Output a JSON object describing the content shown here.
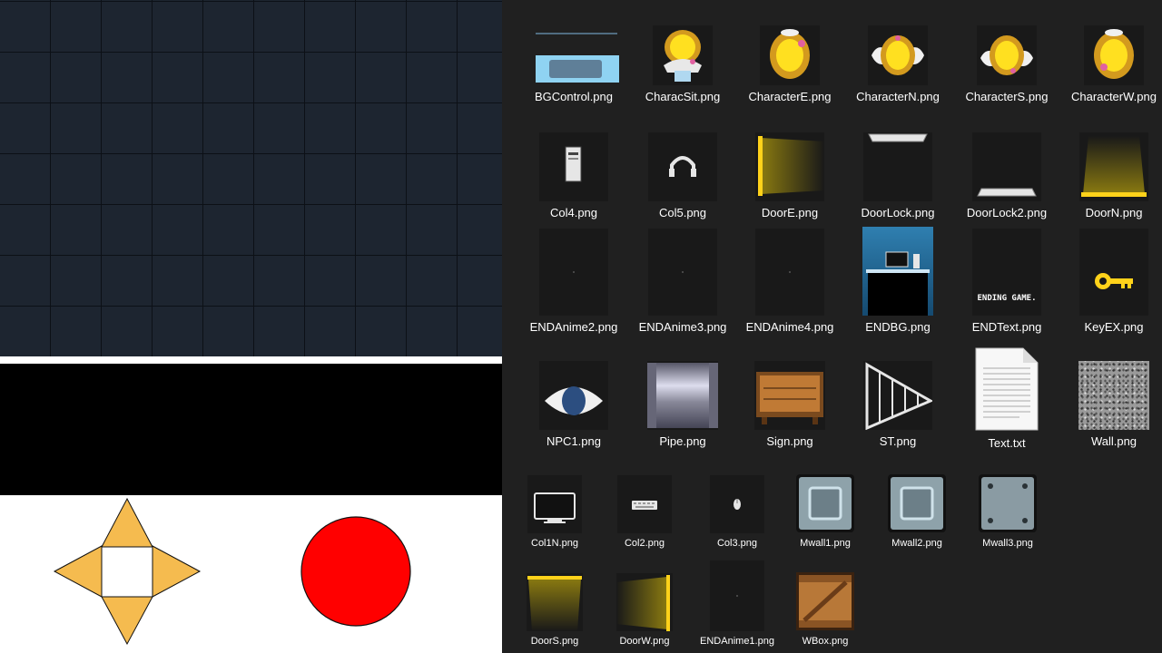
{
  "colors": {
    "grid_bg": "#1d2530",
    "explorer_bg": "#202020",
    "dpad_fill": "#f5bb4f",
    "button_fill": "#ff0000",
    "text": "#ffffff"
  },
  "game": {
    "dpad_icon": "dpad-icon",
    "action_button_icon": "red-circle-button-icon"
  },
  "files": [
    {
      "name": "BGControl.png",
      "icon": "bgcontrol-thumbnail"
    },
    {
      "name": "CharacSit.png",
      "icon": "character-sit-thumbnail"
    },
    {
      "name": "CharacterE.png",
      "icon": "character-east-thumbnail"
    },
    {
      "name": "CharacterN.png",
      "icon": "character-north-thumbnail"
    },
    {
      "name": "CharacterS.png",
      "icon": "character-south-thumbnail"
    },
    {
      "name": "CharacterW.png",
      "icon": "character-west-thumbnail"
    },
    {
      "name": "Col4.png",
      "icon": "pc-tower-thumbnail"
    },
    {
      "name": "Col5.png",
      "icon": "headphones-thumbnail"
    },
    {
      "name": "DoorE.png",
      "icon": "door-east-thumbnail"
    },
    {
      "name": "DoorLock.png",
      "icon": "door-lock-thumbnail"
    },
    {
      "name": "DoorLock2.png",
      "icon": "door-lock2-thumbnail"
    },
    {
      "name": "DoorN.png",
      "icon": "door-north-thumbnail"
    },
    {
      "name": "ENDAnime2.png",
      "icon": "end-anime-thumbnail"
    },
    {
      "name": "ENDAnime3.png",
      "icon": "end-anime-thumbnail"
    },
    {
      "name": "ENDAnime4.png",
      "icon": "end-anime-thumbnail"
    },
    {
      "name": "ENDBG.png",
      "icon": "end-background-thumbnail"
    },
    {
      "name": "ENDText.png",
      "icon": "end-text-thumbnail",
      "caption": "ENDING GAME."
    },
    {
      "name": "KeyEX.png",
      "icon": "key-thumbnail"
    },
    {
      "name": "NPC1.png",
      "icon": "npc-thumbnail"
    },
    {
      "name": "Pipe.png",
      "icon": "pipe-thumbnail"
    },
    {
      "name": "Sign.png",
      "icon": "sign-thumbnail"
    },
    {
      "name": "ST.png",
      "icon": "stairs-thumbnail"
    },
    {
      "name": "Text.txt",
      "icon": "text-document-icon"
    },
    {
      "name": "Wall.png",
      "icon": "wall-texture-thumbnail"
    },
    {
      "name": "Col1N.png",
      "icon": "monitor-thumbnail"
    },
    {
      "name": "Col2.png",
      "icon": "keyboard-thumbnail"
    },
    {
      "name": "Col3.png",
      "icon": "mouse-thumbnail"
    },
    {
      "name": "Mwall1.png",
      "icon": "metal-wall-thumbnail"
    },
    {
      "name": "Mwall2.png",
      "icon": "metal-wall-thumbnail"
    },
    {
      "name": "Mwall3.png",
      "icon": "metal-wall-bolted-thumbnail"
    },
    {
      "name": "DoorS.png",
      "icon": "door-south-thumbnail"
    },
    {
      "name": "DoorW.png",
      "icon": "door-west-thumbnail"
    },
    {
      "name": "ENDAnime1.png",
      "icon": "end-anime-thumbnail"
    },
    {
      "name": "WBox.png",
      "icon": "wooden-box-thumbnail"
    }
  ]
}
